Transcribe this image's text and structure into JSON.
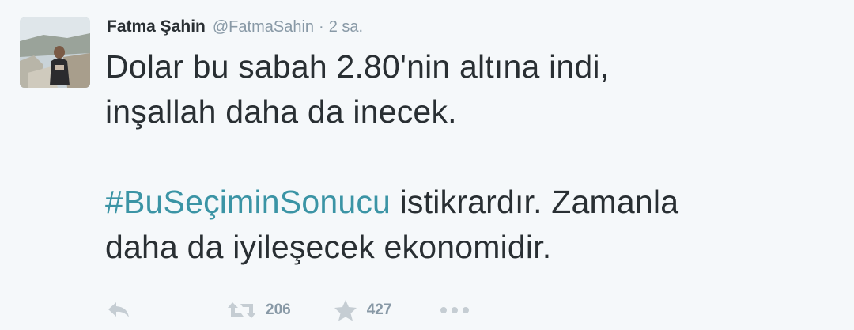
{
  "tweet": {
    "author": {
      "full_name": "Fatma Şahin",
      "username": "@FatmaSahin",
      "avatar_icon": "profile-photo"
    },
    "separator": "·",
    "time": "2 sa.",
    "text": {
      "line1": "Dolar bu sabah 2.80'nin altına indi,",
      "line2": "inşallah daha da inecek.",
      "hashtag": "#BuSeçiminSonucu",
      "line3_rest": " istikrardır. Zamanla",
      "line4": "daha da iyileşecek ekonomidir."
    },
    "actions": {
      "reply_icon": "reply-icon",
      "retweet_icon": "retweet-icon",
      "retweet_count": "206",
      "favorite_icon": "star-icon",
      "favorite_count": "427",
      "more_icon": "more-dots-icon"
    }
  },
  "colors": {
    "background": "#f5f8fa",
    "text": "#292f33",
    "muted": "#8899a6",
    "hashtag": "#3b94a5"
  }
}
